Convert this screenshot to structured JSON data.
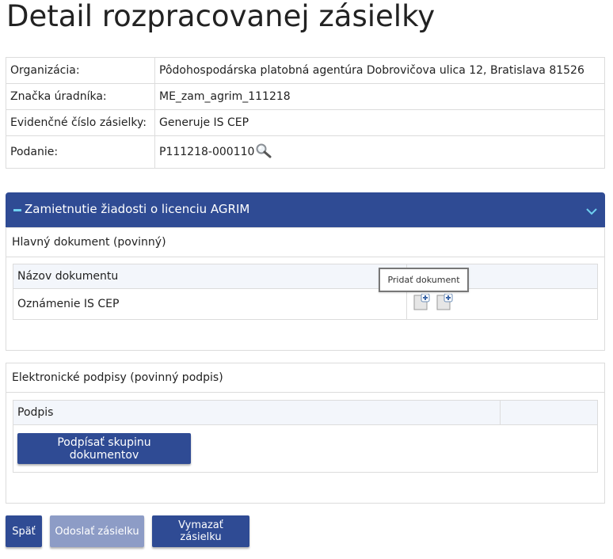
{
  "page": {
    "title": "Detail rozpracovanej zásielky"
  },
  "info": {
    "rows": [
      {
        "label": "Organizácia:",
        "value": "Pôdohospodárska platobná agentúra Dobrovičova ulica 12, Bratislava 81526"
      },
      {
        "label": "Značka úradníka:",
        "value": "ME_zam_agrim_111218"
      },
      {
        "label": "Evidenčné číslo zásielky:",
        "value": "Generuje IS CEP"
      },
      {
        "label": "Podanie:",
        "value": "P111218-000110",
        "icon": "magnifier-icon"
      }
    ]
  },
  "accordion": {
    "title": "Zamietnutie žiadosti o licenciu AGRIM",
    "collapse_icon": "minus-icon",
    "toggle_icon": "chevron-down-icon",
    "accent": "#2f4b94"
  },
  "main_document": {
    "heading": "Hlavný dokument (povinný)",
    "column_header": "Názov dokumentu",
    "rows": [
      {
        "name": "Oznámenie IS CEP",
        "icons": [
          "add-document-icon",
          "add-document-icon"
        ]
      }
    ],
    "tooltip": "Pridať dokument"
  },
  "signatures": {
    "heading": "Elektronické podpisy (povinný podpis)",
    "column_header": "Podpis",
    "sign_button": "Podpísať skupinu dokumentov"
  },
  "footer": {
    "back": "Späť",
    "send": "Odoslať zásielku",
    "delete": "Vymazať zásielku"
  }
}
